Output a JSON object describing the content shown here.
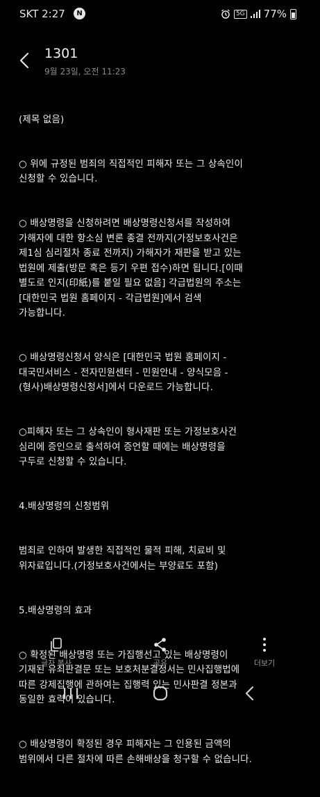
{
  "status_bar": {
    "carrier_time": "SKT 2:27",
    "badge": "N",
    "network": "5G",
    "battery_pct": "77%",
    "battery_level": 0.77
  },
  "header": {
    "title": "1301",
    "date": "9월 23일, 오전 11:23"
  },
  "note": {
    "paragraphs": [
      "(제목 없음)",
      "○ 위에 규정된 범죄의 직접적인 피해자 또는 그 상속인이\n신청할 수 있습니다.",
      "○ 배상명령을 신청하려면 배상명령신청서를 작성하여\n가해자에 대한 항소심 변론 종결 전까지(가정보호사건은\n제1심 심리절차 종료 전까지) 가해자가 재판을 받고 있는\n법원에 제출(방문 혹은 등기 우편 접수)하면 됩니다.[이때\n별도로 인지(印紙)를 붙일 필요 없음] 각급법원의 주소는\n[대한민국 법원 홈페이지 - 각급법원]에서 검색\n가능합니다.",
      "○ 배상명령신청서 양식은 [대한민국 법원 홈페이지 -\n대국민서비스 - 전자민원센터 - 민원안내 - 양식모음 -\n(형사)배상명령신청서]에서 다운로드 가능합니다.",
      "○피해자 또는 그 상속인이 형사재판 또는 가정보호사건\n심리에 증인으로 출석하여 증언할 때에는 배상명령을\n구두로 신청할 수 있습니다.",
      "4.배상명령의 신청범위",
      "  범죄로 인하여 발생한 직접적인 물적 피해, 치료비 및\n위자료입니다.(가정보호사건에서는 부양료도 포함)",
      "5.배상명령의 효과",
      "○ 확정된 배상명령 또는 가집행선고 있는 배상명령이\n기재된 유죄판결문 또는 보호처분결정서는 민사집행법에\n따른 강제집행에 관하여는 집행력 있는 민사판결 정본과\n동일한 효력이 있습니다.",
      "○ 배상명령이 확정된 경우 피해자는 그 인용된 금액의\n범위에서 다른 절차에 따른 손해배상을 청구할 수 없습니다."
    ]
  },
  "toolbar": {
    "copy_label": "글자 복사",
    "share_label": "공유",
    "more_label": "더보기"
  }
}
